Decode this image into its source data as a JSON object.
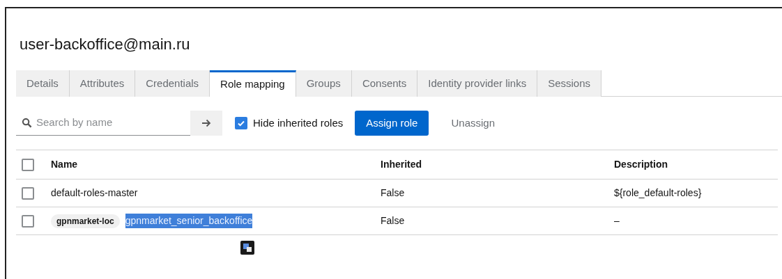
{
  "title": "user-backoffice@main.ru",
  "tabs": [
    {
      "label": "Details",
      "selected": false
    },
    {
      "label": "Attributes",
      "selected": false
    },
    {
      "label": "Credentials",
      "selected": false
    },
    {
      "label": "Role mapping",
      "selected": true
    },
    {
      "label": "Groups",
      "selected": false
    },
    {
      "label": "Consents",
      "selected": false
    },
    {
      "label": "Identity provider links",
      "selected": false
    },
    {
      "label": "Sessions",
      "selected": false
    }
  ],
  "toolbar": {
    "search": {
      "placeholder": "Search by name"
    },
    "hide_inherited": {
      "label": "Hide inherited roles",
      "checked": true
    },
    "assign_button": "Assign role",
    "unassign_button": "Unassign"
  },
  "table": {
    "columns": [
      "Name",
      "Inherited",
      "Description"
    ],
    "select_all_checked": false,
    "rows": [
      {
        "checked": false,
        "name": "default-roles-master",
        "name_highlighted": false,
        "inherited": "False",
        "description": "${role_default-roles}"
      },
      {
        "checked": false,
        "client": "gpnmarket-loc",
        "name": "gpnmarket_senior_backoffice",
        "name_highlighted": true,
        "inherited": "False",
        "description": "–"
      }
    ]
  }
}
